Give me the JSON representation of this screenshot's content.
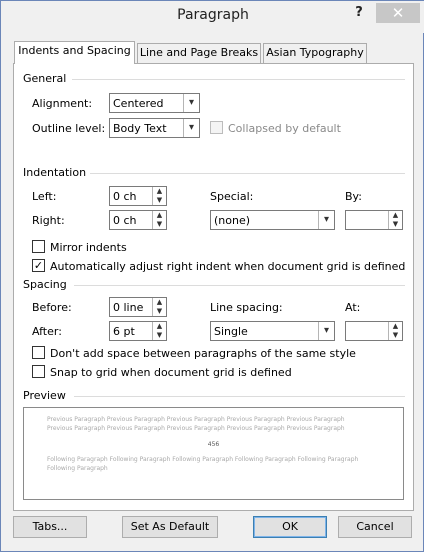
{
  "window": {
    "title": "Paragraph",
    "help": "?",
    "close": "✕"
  },
  "tabs": [
    {
      "label": "Indents and Spacing",
      "active": true
    },
    {
      "label": "Line and Page Breaks",
      "active": false
    },
    {
      "label": "Asian Typography",
      "active": false
    }
  ],
  "general": {
    "heading": "General",
    "alignment_label": "Alignment:",
    "alignment_value": "Centered",
    "outline_label": "Outline level:",
    "outline_value": "Body Text",
    "collapsed_label": "Collapsed by default",
    "collapsed_checked": false
  },
  "indentation": {
    "heading": "Indentation",
    "left_label": "Left:",
    "left_value": "0 ch",
    "right_label": "Right:",
    "right_value": "0 ch",
    "special_label": "Special:",
    "special_value": "(none)",
    "by_label": "By:",
    "by_value": "",
    "mirror_label": "Mirror indents",
    "mirror_checked": false,
    "auto_adjust_label": "Automatically adjust right indent when document grid is defined",
    "auto_adjust_checked": true
  },
  "spacing": {
    "heading": "Spacing",
    "before_label": "Before:",
    "before_value": "0 line",
    "after_label": "After:",
    "after_value": "6 pt",
    "line_spacing_label": "Line spacing:",
    "line_spacing_value": "Single",
    "at_label": "At:",
    "at_value": "",
    "dont_add_label": "Don't add space between paragraphs of the same style",
    "dont_add_checked": false,
    "snap_label": "Snap to grid when document grid is defined",
    "snap_checked": false
  },
  "preview": {
    "heading": "Preview",
    "prev_line1": "Previous Paragraph Previous Paragraph Previous Paragraph Previous Paragraph Previous Paragraph",
    "prev_line2": "Previous Paragraph Previous Paragraph Previous Paragraph Previous Paragraph Previous Paragraph",
    "sample": "456",
    "follow_line1": "Following Paragraph Following Paragraph Following Paragraph Following Paragraph Following Paragraph",
    "follow_line2": "Following Paragraph"
  },
  "buttons": {
    "tabs": "Tabs...",
    "set_default": "Set As Default",
    "ok": "OK",
    "cancel": "Cancel"
  },
  "icons": {
    "dropdown": "▾",
    "spin_up": "▲",
    "spin_down": "▼",
    "checkmark": "✓"
  }
}
